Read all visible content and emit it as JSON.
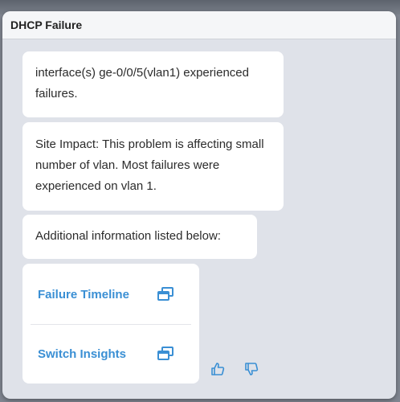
{
  "panel": {
    "title": "DHCP Failure"
  },
  "messages": [
    {
      "text": "interface(s) ge-0/0/5(vlan1) experienced failures."
    },
    {
      "text": "Site Impact: This problem is affecting small number of vlan. Most failures were experienced on vlan 1."
    },
    {
      "text": "Additional information listed below:"
    }
  ],
  "links": [
    {
      "label": "Failure Timeline",
      "icon": "open-window-icon"
    },
    {
      "label": "Switch Insights",
      "icon": "open-window-icon"
    }
  ],
  "feedback": {
    "up_icon": "thumbs-up-icon",
    "down_icon": "thumbs-down-icon"
  },
  "colors": {
    "link": "#3a8fd4",
    "panel_bg": "#dfe2e9",
    "header_bg": "#f5f6f8",
    "bubble_bg": "#ffffff"
  }
}
